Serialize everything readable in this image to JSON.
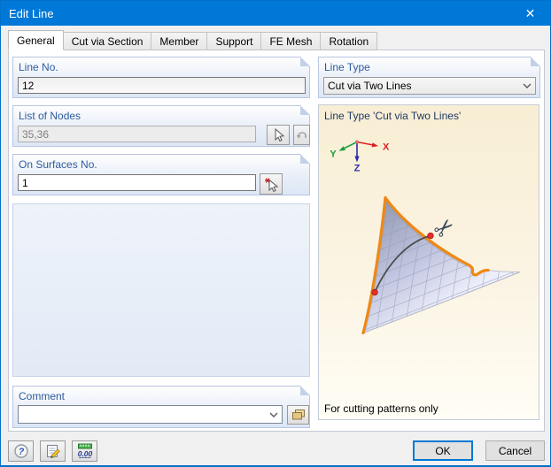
{
  "titlebar": {
    "title": "Edit Line"
  },
  "icons": {
    "close_glyph": "✕",
    "help_glyph": "?",
    "scissors_glyph": "✂"
  },
  "tabs": [
    {
      "label": "General",
      "active": true
    },
    {
      "label": "Cut via Section",
      "active": false
    },
    {
      "label": "Member",
      "active": false
    },
    {
      "label": "Support",
      "active": false
    },
    {
      "label": "FE Mesh",
      "active": false
    },
    {
      "label": "Rotation",
      "active": false
    }
  ],
  "left": {
    "line_no": {
      "label": "Line No.",
      "value": "12"
    },
    "list_of_nodes": {
      "label": "List of Nodes",
      "value": "35,36"
    },
    "on_surfaces": {
      "label": "On Surfaces No.",
      "value": "1"
    },
    "comment": {
      "label": "Comment",
      "value": ""
    }
  },
  "right": {
    "line_type": {
      "label": "Line Type",
      "value": "Cut via Two Lines"
    },
    "preview": {
      "title": "Line Type 'Cut via Two Lines'",
      "footer": "For cutting patterns only",
      "axis_labels": {
        "x": "X",
        "y": "Y",
        "z": "Z"
      }
    }
  },
  "footer": {
    "ok": "OK",
    "cancel": "Cancel",
    "units_label": "0.00"
  },
  "colors": {
    "titlebar": "#0078d7",
    "accent": "#0078d7",
    "group_label": "#2e5c9e",
    "axis_x": "#dc2020",
    "axis_y": "#1a9e3f",
    "axis_z": "#2b2bb0",
    "surface_edge_orange": "#ef8815",
    "cut_node_red": "#e22d2d",
    "cut_line": "#4b4b4b"
  }
}
